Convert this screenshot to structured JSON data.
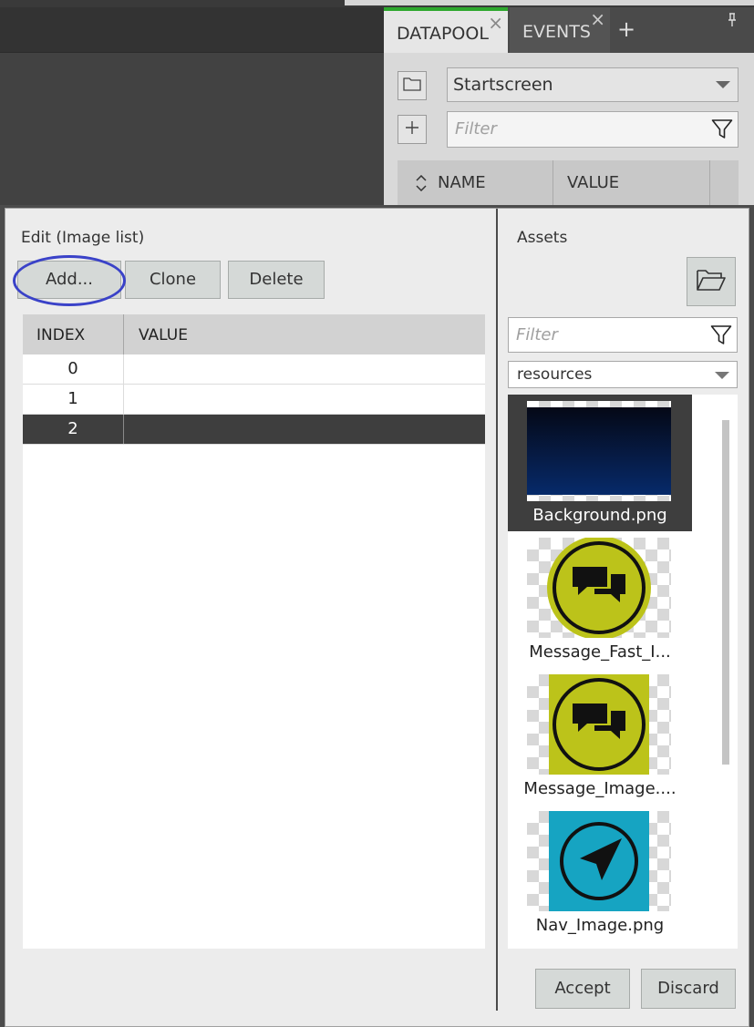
{
  "datapool_panel": {
    "tabs": [
      {
        "label": "DATAPOOL",
        "active": true
      },
      {
        "label": "EVENTS",
        "active": false
      }
    ],
    "screen_select": "Startscreen",
    "filter_placeholder": "Filter",
    "columns": [
      "NAME",
      "VALUE"
    ]
  },
  "dialog": {
    "edit_title": "Edit  (Image list)",
    "buttons": {
      "add": "Add...",
      "clone": "Clone",
      "delete": "Delete",
      "accept": "Accept",
      "discard": "Discard"
    },
    "grid": {
      "columns": [
        "INDEX",
        "VALUE"
      ],
      "rows": [
        {
          "index": "0",
          "value": ""
        },
        {
          "index": "1",
          "value": ""
        },
        {
          "index": "2",
          "value": "",
          "selected": true
        }
      ]
    },
    "assets": {
      "title": "Assets",
      "filter_placeholder": "Filter",
      "folder_select": "resources",
      "items": [
        {
          "label": "Background.png",
          "icon": "dark-gradient",
          "selected": true
        },
        {
          "label": "Message_Fast_I...",
          "icon": "message-round",
          "color": "#bcc31a"
        },
        {
          "label": "Message_Image....",
          "icon": "message-square",
          "color": "#bcc31a"
        },
        {
          "label": "Nav_Image.png",
          "icon": "navigation-arrow",
          "color": "#16a4c2"
        }
      ]
    }
  },
  "colors": {
    "active_tab_accent": "#2ea82e",
    "highlight_circle": "#3a42c8",
    "selection": "#3e3e3e"
  }
}
